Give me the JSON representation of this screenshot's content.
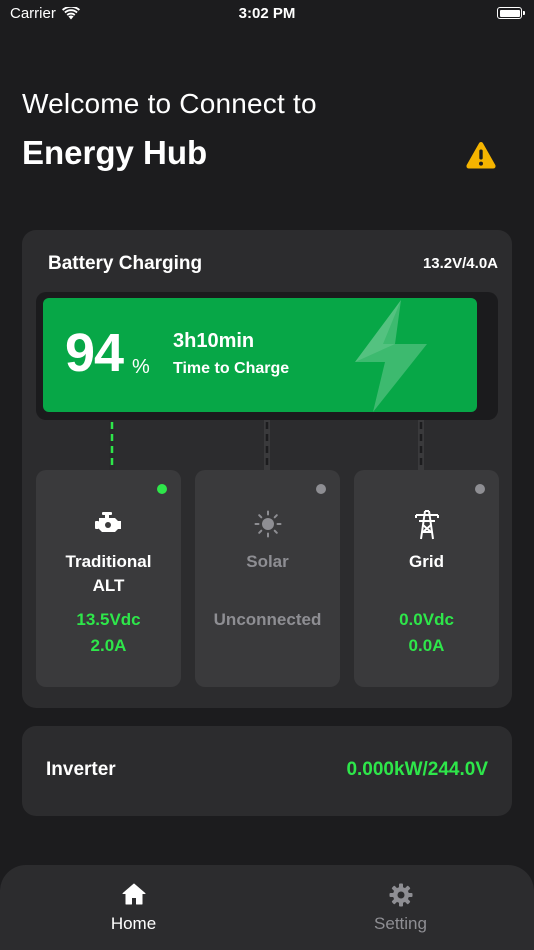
{
  "status_bar": {
    "carrier": "Carrier",
    "time": "3:02 PM"
  },
  "header": {
    "welcome": "Welcome to Connect to",
    "title": "Energy Hub"
  },
  "battery": {
    "title": "Battery Charging",
    "reading": "13.2V/4.0A",
    "percent": "94",
    "percent_unit": "%",
    "time_value": "3h10min",
    "time_label": "Time to Charge"
  },
  "sources": [
    {
      "name": "Traditional ALT",
      "line1": "13.5Vdc",
      "line2": "2.0A",
      "status": "connected",
      "icon": "engine-icon"
    },
    {
      "name": "Solar",
      "line1": "Unconnected",
      "line2": "",
      "status": "unconnected",
      "icon": "sun-icon"
    },
    {
      "name": "Grid",
      "line1": "0.0Vdc",
      "line2": "0.0A",
      "status": "idle",
      "icon": "power-tower-icon"
    }
  ],
  "inverter": {
    "label": "Inverter",
    "value": "0.000kW/244.0V"
  },
  "tabs": [
    {
      "label": "Home",
      "icon": "home-icon",
      "active": true
    },
    {
      "label": "Setting",
      "icon": "gear-icon",
      "active": false
    }
  ],
  "colors": {
    "background": "#1c1c1e",
    "card": "#2c2c2e",
    "tile": "#3a3a3c",
    "charge_green": "#07a747",
    "value_green": "#2ee64a",
    "warning": "#f5b400",
    "muted": "#8e8e93"
  }
}
